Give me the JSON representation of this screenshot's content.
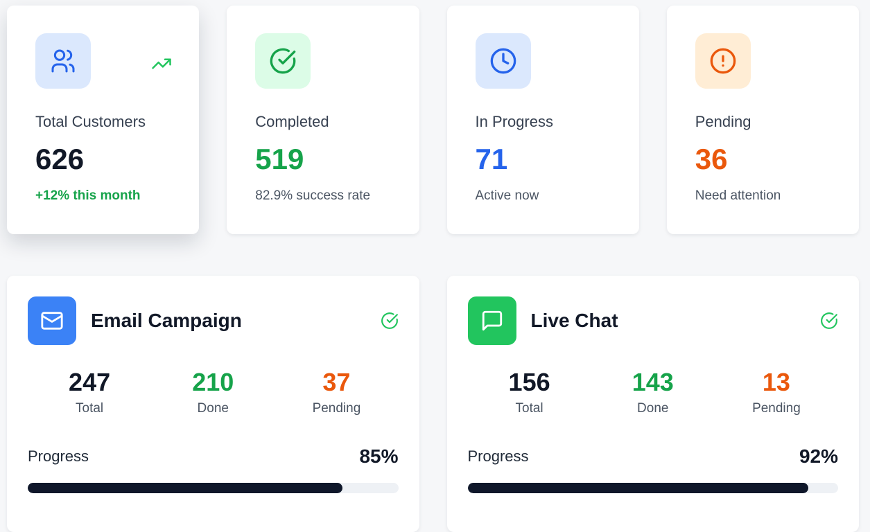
{
  "stats": [
    {
      "label": "Total Customers",
      "value": "626",
      "sub": "+12% this month",
      "icon": "users-icon",
      "value_color": "#111827",
      "sub_color": "#16a34a",
      "tile_bg": "#dbe8fd",
      "icon_color": "#2563eb"
    },
    {
      "label": "Completed",
      "value": "519",
      "sub": "82.9% success rate",
      "icon": "check-circle-icon",
      "value_color": "#16a34a",
      "sub_color": "#4b5563",
      "tile_bg": "#dcfce7",
      "icon_color": "#16a34a"
    },
    {
      "label": "In Progress",
      "value": "71",
      "sub": "Active now",
      "icon": "clock-icon",
      "value_color": "#2563eb",
      "sub_color": "#4b5563",
      "tile_bg": "#dbe8fd",
      "icon_color": "#2563eb"
    },
    {
      "label": "Pending",
      "value": "36",
      "sub": "Need attention",
      "icon": "alert-circle-icon",
      "value_color": "#ea580c",
      "sub_color": "#4b5563",
      "tile_bg": "#ffedd5",
      "icon_color": "#ea580c"
    }
  ],
  "channels": [
    {
      "title": "Email Campaign",
      "icon": "mail-icon",
      "icon_bg": "#3b82f6",
      "metrics": [
        {
          "value": "247",
          "label": "Total",
          "color": "#111827"
        },
        {
          "value": "210",
          "label": "Done",
          "color": "#16a34a"
        },
        {
          "value": "37",
          "label": "Pending",
          "color": "#ea580c"
        }
      ],
      "progress_label": "Progress",
      "progress_text": "85%",
      "progress": 0.85
    },
    {
      "title": "Live Chat",
      "icon": "message-square-icon",
      "icon_bg": "#22c55e",
      "metrics": [
        {
          "value": "156",
          "label": "Total",
          "color": "#111827"
        },
        {
          "value": "143",
          "label": "Done",
          "color": "#16a34a"
        },
        {
          "value": "13",
          "label": "Pending",
          "color": "#ea580c"
        }
      ],
      "progress_label": "Progress",
      "progress_text": "92%",
      "progress": 0.92
    }
  ],
  "colors": {
    "accent_green": "#22c55e",
    "bar_fill": "#0f172a",
    "bar_track": "#eef1f5"
  }
}
